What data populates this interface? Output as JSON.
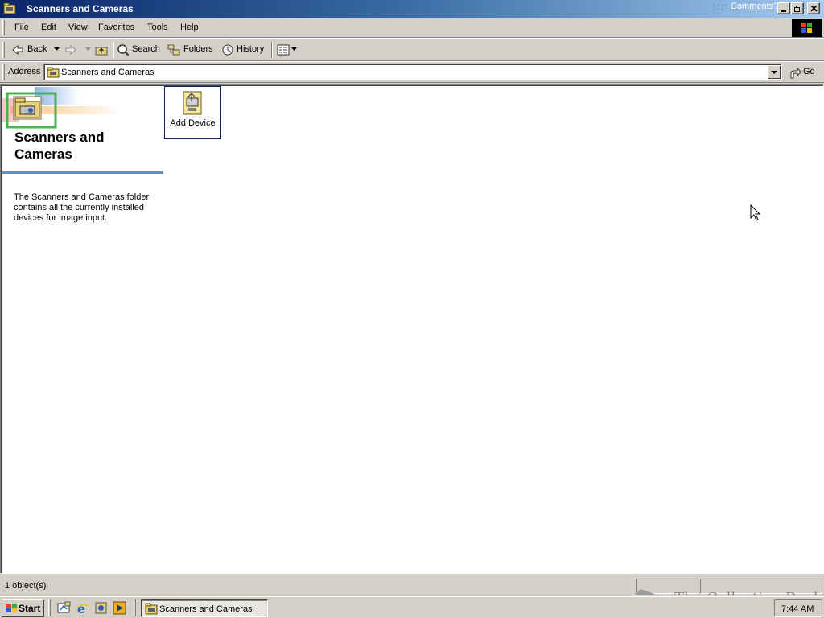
{
  "window": {
    "title": "Scanners and Cameras",
    "comments_link": "Comments?"
  },
  "menu": {
    "items": [
      "File",
      "Edit",
      "View",
      "Favorites",
      "Tools",
      "Help"
    ]
  },
  "toolbar": {
    "back_label": "Back",
    "search_label": "Search",
    "folders_label": "Folders",
    "history_label": "History"
  },
  "address": {
    "label": "Address",
    "value": "Scanners and Cameras",
    "go_label": "Go"
  },
  "sidepanel": {
    "title": "Scanners and Cameras",
    "description": "The Scanners and Cameras folder contains all the currently installed devices for image input."
  },
  "items": [
    {
      "label": "Add Device",
      "icon": "add-device-icon",
      "selected": true
    }
  ],
  "status": {
    "text": "1 object(s)"
  },
  "watermark": {
    "text": "The Collection Book"
  },
  "taskbar": {
    "start_label": "Start",
    "quick_launch": [
      "show-desktop-icon",
      "internet-explorer-icon",
      "channels-icon",
      "media-player-icon"
    ],
    "tasks": [
      {
        "label": "Scanners and Cameras",
        "active": true
      }
    ],
    "clock": "7:44 AM"
  },
  "colors": {
    "title_start": "#0a246a",
    "title_end": "#a6caf0",
    "face": "#d4d0c8",
    "divider": "#5b8fc6"
  }
}
